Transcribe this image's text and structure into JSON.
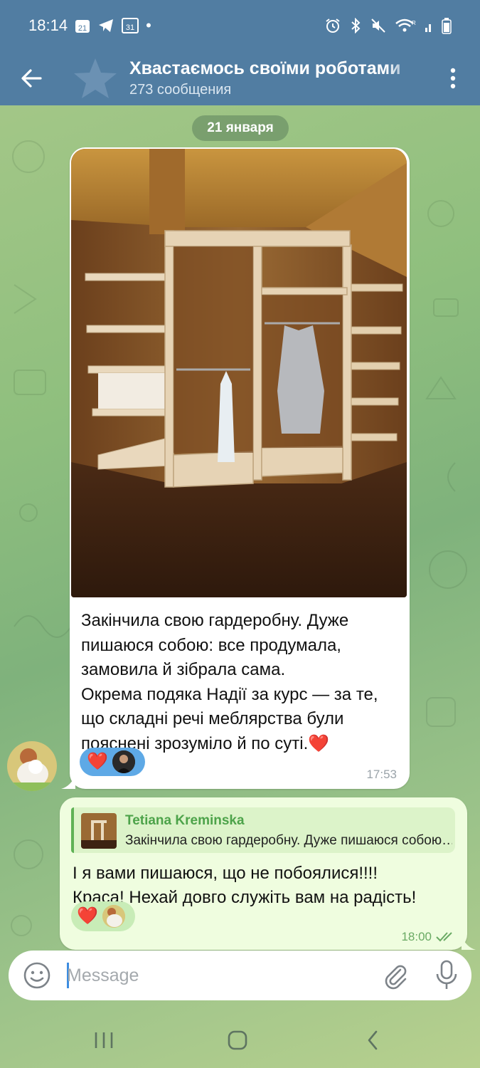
{
  "status_bar": {
    "time": "18:14",
    "calendar_day": "21",
    "calendar_day_2": "31",
    "dot": "•"
  },
  "header": {
    "title": "Хвастаємось своїми роботами",
    "subtitle": "273 сообщения"
  },
  "date_chip": "21 января",
  "incoming_message": {
    "text": "Закінчила свою гардеробну. Дуже пишаюся собою: все продумала, замовила й зібрала сама.\nОкрема подяка Надії за курс — за те, що складні речі меблярства були пояснені зрозуміло й по суті.❤️",
    "reaction_emoji": "❤️",
    "time": "17:53"
  },
  "outgoing_message": {
    "reply_name": "Tetiana Kreminska",
    "reply_text": "Закінчила свою гардеробну. Дуже пишаюся собою",
    "text": "І я вами пишаюся, що не побоялися!!!!\nКраса! Нехай довго служіть вам на радість!",
    "reaction_emoji": "❤️",
    "time": "18:00"
  },
  "input": {
    "placeholder": "Message",
    "value": ""
  },
  "colors": {
    "header_bg": "#517da2",
    "incoming_bg": "#ffffff",
    "outgoing_bg": "#effddf",
    "accent_green": "#5fb256",
    "reaction_blue": "#5ea9e6"
  },
  "icons": [
    "back-arrow-icon",
    "star-icon",
    "more-vert-icon",
    "emoji-icon",
    "paperclip-icon",
    "microphone-icon",
    "double-check-icon",
    "recents-icon",
    "home-icon",
    "nav-back-icon"
  ]
}
